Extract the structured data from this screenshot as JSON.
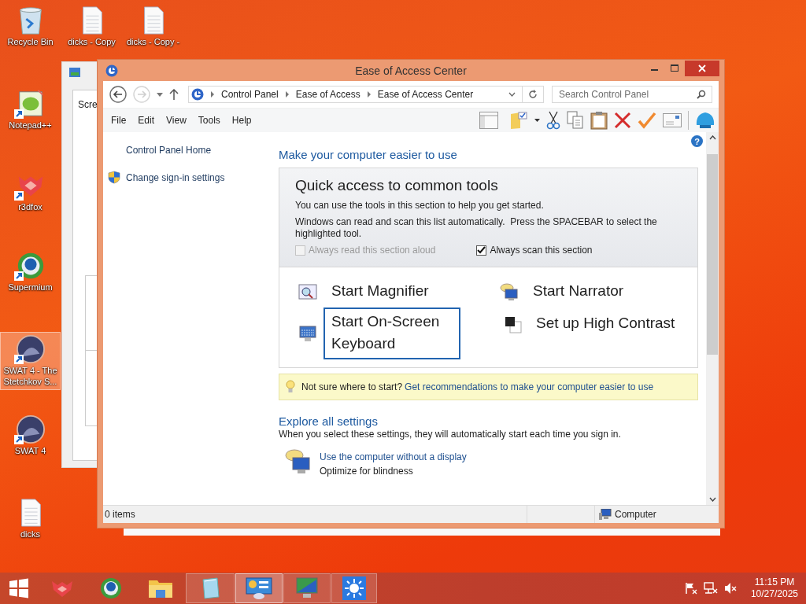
{
  "desktop_icons": [
    {
      "label": "Recycle Bin",
      "kind": "recycle",
      "shortcut": false,
      "selected": false
    },
    {
      "label": "dicks - Copy",
      "kind": "file",
      "shortcut": false,
      "selected": false
    },
    {
      "label": "dicks - Copy -",
      "kind": "file",
      "shortcut": false,
      "selected": false
    },
    {
      "label": "Notepad++",
      "kind": "notepad",
      "shortcut": true,
      "selected": false
    },
    {
      "label": "r3dfox",
      "kind": "fox",
      "shortcut": true,
      "selected": false
    },
    {
      "label": "Supermium",
      "kind": "browser",
      "shortcut": true,
      "selected": false
    },
    {
      "label": "SWAT 4 - The Stetchkov S...",
      "kind": "game",
      "shortcut": true,
      "selected": true
    },
    {
      "label": "SWAT 4",
      "kind": "game",
      "shortcut": true,
      "selected": false
    },
    {
      "label": "dicks",
      "kind": "file",
      "shortcut": false,
      "selected": false
    }
  ],
  "background_window": {
    "texts": [
      "Scre"
    ]
  },
  "window": {
    "title": "Ease of Access Center",
    "nav": {
      "forward_disabled": true,
      "breadcrumb": [
        "Control Panel",
        "Ease of Access",
        "Ease of Access Center"
      ],
      "search_placeholder": "Search Control Panel"
    },
    "menu": [
      "File",
      "Edit",
      "View",
      "Tools",
      "Help"
    ],
    "sidebar": [
      {
        "label": "Control Panel Home",
        "kind": "plain"
      },
      {
        "label": "Change sign-in settings",
        "kind": "shield"
      }
    ],
    "help": "?",
    "heading": "Make your computer easier to use",
    "quick_access": {
      "title": "Quick access to common tools",
      "paragraphs": [
        "You can use the tools in this section to help you get started.",
        "Windows can read and scan this list automatically.  Press the SPACEBAR to select the highlighted tool."
      ],
      "options": [
        {
          "label": "Always read this section aloud",
          "checked": false,
          "disabled": true
        },
        {
          "label": "Always scan this section",
          "checked": true,
          "disabled": false
        }
      ],
      "tools": [
        {
          "label": "Start Magnifier",
          "kind": "magnifier",
          "selected": false
        },
        {
          "label": "Start Narrator",
          "kind": "narrator",
          "selected": false
        },
        {
          "label": "Start On-Screen Keyboard",
          "kind": "keyboard",
          "selected": true
        },
        {
          "label": "Set up High Contrast",
          "kind": "contrast",
          "selected": false
        }
      ]
    },
    "tip": {
      "prompt": "Not sure where to start?",
      "link": "Get recommendations to make your computer easier to use"
    },
    "explore": {
      "title": "Explore all settings",
      "description": "When you select these settings, they will automatically start each time you sign in.",
      "items": [
        {
          "link": "Use the computer without a display",
          "description": "Optimize for blindness"
        }
      ]
    },
    "status_bar": {
      "count": "0 items",
      "location": "Computer"
    }
  },
  "taskbar": {
    "items": [
      {
        "kind": "start",
        "running": false,
        "selected": false
      },
      {
        "kind": "fox",
        "running": false,
        "selected": false
      },
      {
        "kind": "browser",
        "running": false,
        "selected": false
      },
      {
        "kind": "folder",
        "running": false,
        "selected": false
      },
      {
        "kind": "notepad",
        "running": true,
        "selected": false
      },
      {
        "kind": "control",
        "running": true,
        "selected": true
      },
      {
        "kind": "monitor",
        "running": true,
        "selected": false
      },
      {
        "kind": "sun",
        "running": true,
        "selected": false
      }
    ],
    "clock": {
      "time": "11:15 PM",
      "date": "10/27/2025"
    }
  }
}
